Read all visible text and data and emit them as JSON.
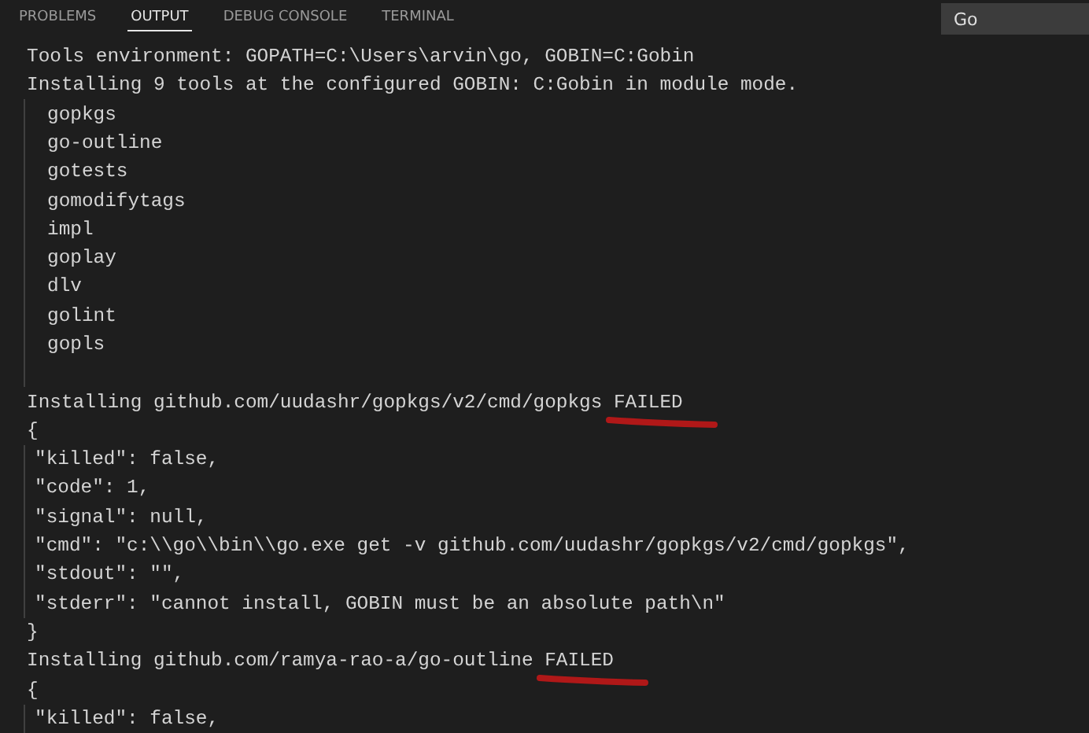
{
  "tabs": [
    {
      "label": "PROBLEMS",
      "selected": false
    },
    {
      "label": "OUTPUT",
      "selected": true
    },
    {
      "label": "DEBUG CONSOLE",
      "selected": false
    },
    {
      "label": "TERMINAL",
      "selected": false
    }
  ],
  "channel_select": {
    "value": "Go"
  },
  "output_lines": [
    {
      "kind": "plain",
      "text": "Tools environment: GOPATH=C:\\Users\\arvin\\go, GOBIN=C:Gobin"
    },
    {
      "kind": "plain",
      "text": "Installing 9 tools at the configured GOBIN: C:Gobin in module mode."
    },
    {
      "kind": "tool",
      "text": "gopkgs"
    },
    {
      "kind": "tool",
      "text": "go-outline"
    },
    {
      "kind": "tool",
      "text": "gotests"
    },
    {
      "kind": "tool",
      "text": "gomodifytags"
    },
    {
      "kind": "tool",
      "text": "impl"
    },
    {
      "kind": "tool",
      "text": "goplay"
    },
    {
      "kind": "tool",
      "text": "dlv"
    },
    {
      "kind": "tool",
      "text": "golint"
    },
    {
      "kind": "tool",
      "text": "gopls"
    },
    {
      "kind": "blank"
    },
    {
      "kind": "install",
      "text": "Installing github.com/uudashr/gopkgs/v2/cmd/gopkgs",
      "status": "FAILED"
    },
    {
      "kind": "plain",
      "text": "{"
    },
    {
      "kind": "field",
      "text": "\"killed\": false,"
    },
    {
      "kind": "field",
      "text": "\"code\": 1,"
    },
    {
      "kind": "field",
      "text": "\"signal\": null,"
    },
    {
      "kind": "field",
      "text": "\"cmd\": \"c:\\\\go\\\\bin\\\\go.exe get -v github.com/uudashr/gopkgs/v2/cmd/gopkgs\","
    },
    {
      "kind": "field",
      "text": "\"stdout\": \"\","
    },
    {
      "kind": "field",
      "text": "\"stderr\": \"cannot install, GOBIN must be an absolute path\\n\""
    },
    {
      "kind": "plain",
      "text": "}"
    },
    {
      "kind": "install",
      "text": "Installing github.com/ramya-rao-a/go-outline",
      "status": "FAILED"
    },
    {
      "kind": "plain",
      "text": "{"
    },
    {
      "kind": "field",
      "text": "\"killed\": false,"
    }
  ]
}
